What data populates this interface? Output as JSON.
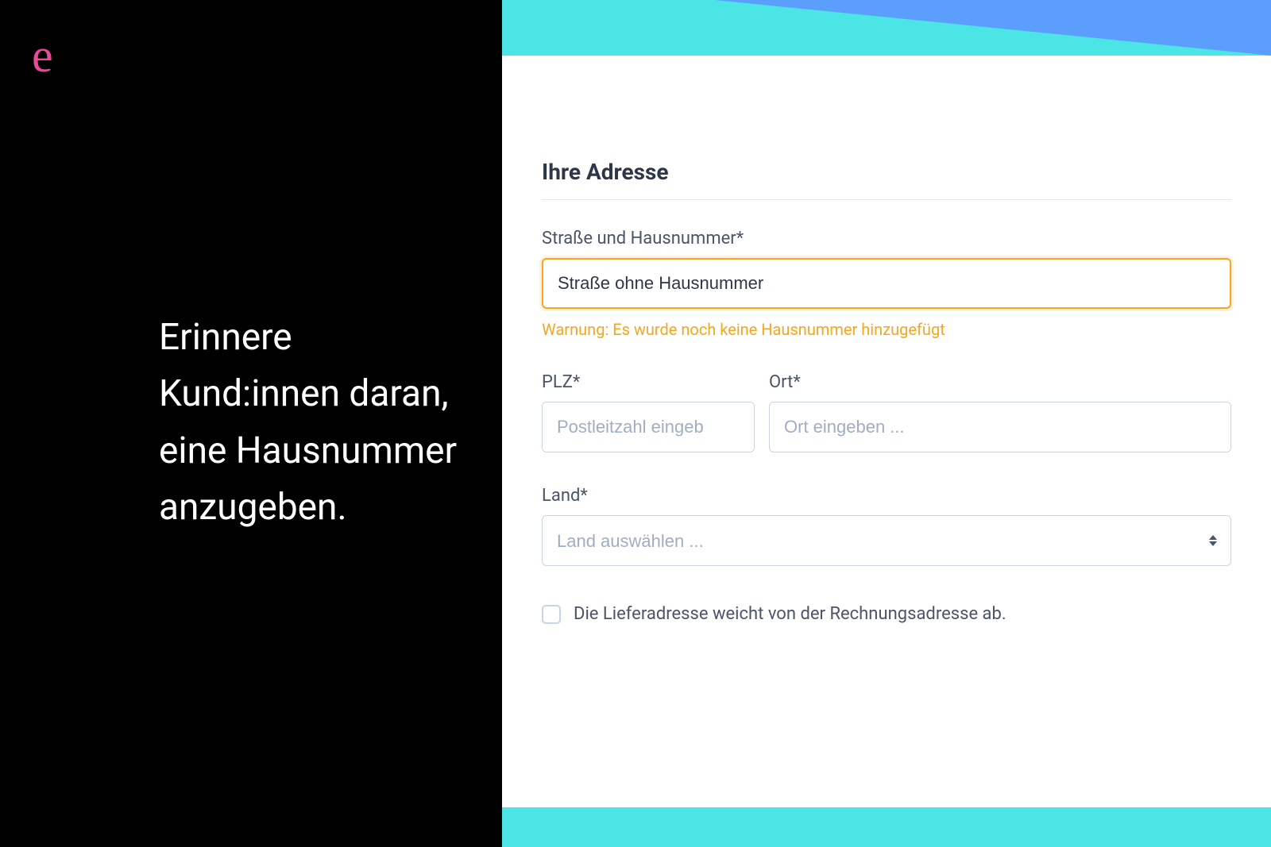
{
  "logo": "e",
  "tagline": "Erinnere Kund:innen daran, eine Hausnummer anzugeben.",
  "form": {
    "title": "Ihre Adresse",
    "street": {
      "label": "Straße und Hausnummer*",
      "value": "Straße ohne Hausnummer",
      "warning": "Warnung: Es wurde noch keine Hausnummer hinzugefügt"
    },
    "postal": {
      "label": "PLZ*",
      "placeholder": "Postleitzahl eingeb"
    },
    "city": {
      "label": "Ort*",
      "placeholder": "Ort eingeben ..."
    },
    "country": {
      "label": "Land*",
      "placeholder": "Land auswählen ..."
    },
    "checkbox": {
      "label": "Die Lieferadresse weicht von der Rechnungsadresse ab."
    }
  }
}
